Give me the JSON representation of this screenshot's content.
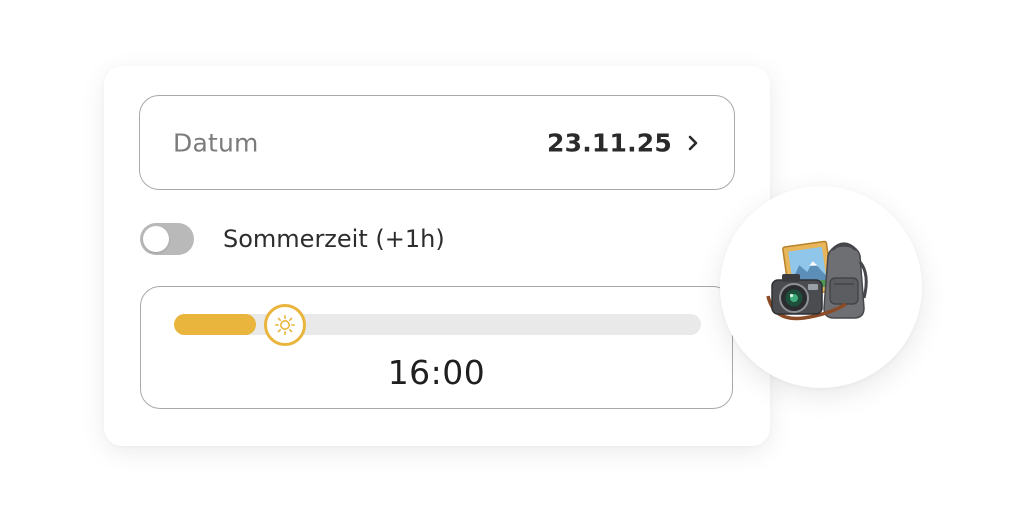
{
  "date_field": {
    "label": "Datum",
    "value": "23.11.25",
    "chevron_icon": "chevron-right-icon"
  },
  "dst_toggle": {
    "label": "Sommerzeit (+1h)",
    "on": false
  },
  "time_slider": {
    "value_label": "16:00",
    "level": 0.14,
    "thumb_icon": "sun-icon",
    "accent_color": "#e9b53c",
    "track_color": "#e9e9e9"
  },
  "badge": {
    "icon": "camera-backpack-icon"
  }
}
